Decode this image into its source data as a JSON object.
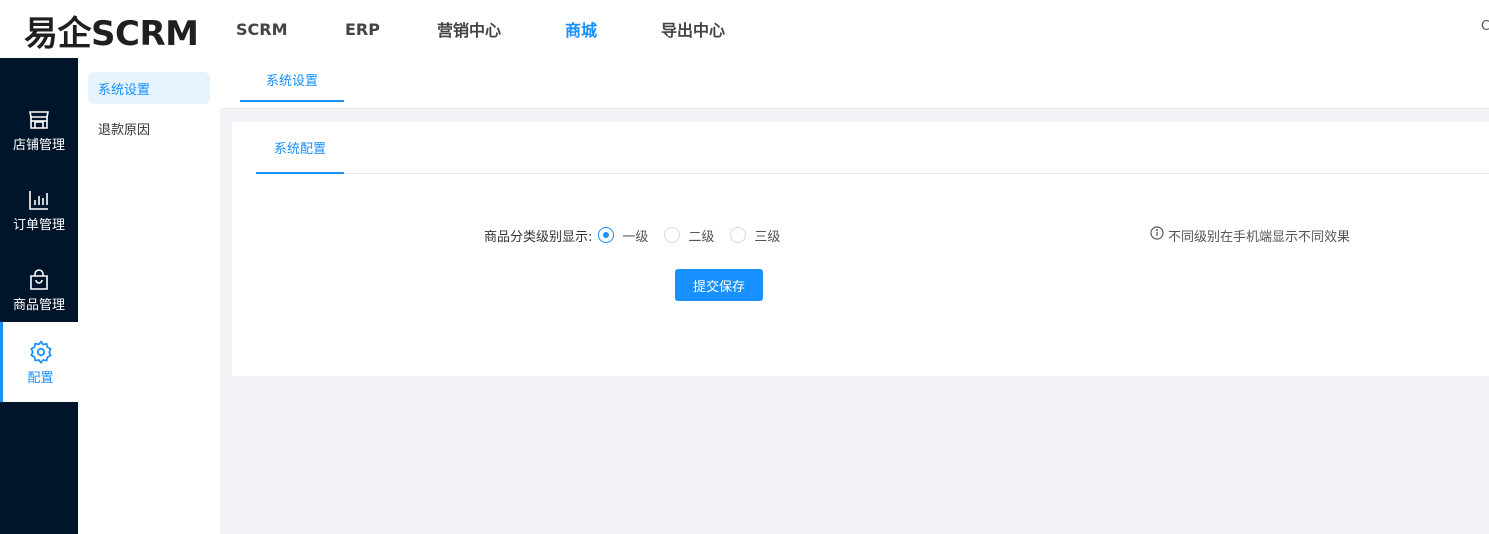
{
  "brand": {
    "logo": "易企SCRM"
  },
  "topnav": {
    "items": [
      {
        "label": "SCRM"
      },
      {
        "label": "ERP"
      },
      {
        "label": "营销中心"
      },
      {
        "label": "商城",
        "active": true
      },
      {
        "label": "导出中心"
      }
    ],
    "corner_glyph": "C"
  },
  "leftbar": {
    "items": [
      {
        "label": "店铺管理",
        "icon": "store-icon"
      },
      {
        "label": "订单管理",
        "icon": "bar-chart-icon"
      },
      {
        "label": "商品管理",
        "icon": "shopping-bag-icon"
      },
      {
        "label": "配置",
        "icon": "gear-icon",
        "active": true
      }
    ]
  },
  "subnav": {
    "items": [
      {
        "label": "系统设置",
        "active": true
      },
      {
        "label": "退款原因"
      }
    ]
  },
  "main": {
    "tab": "系统设置",
    "card": {
      "tab": "系统配置",
      "form": {
        "label": "商品分类级别显示:",
        "options": [
          {
            "label": "一级",
            "checked": true
          },
          {
            "label": "二级",
            "checked": false
          },
          {
            "label": "三级",
            "checked": false
          }
        ],
        "hint": "不同级别在手机端显示不同效果",
        "submit_label": "提交保存"
      }
    }
  },
  "colors": {
    "accent": "#1890ff",
    "sidebar_bg": "#001529",
    "page_bg": "#f0f2f5"
  }
}
